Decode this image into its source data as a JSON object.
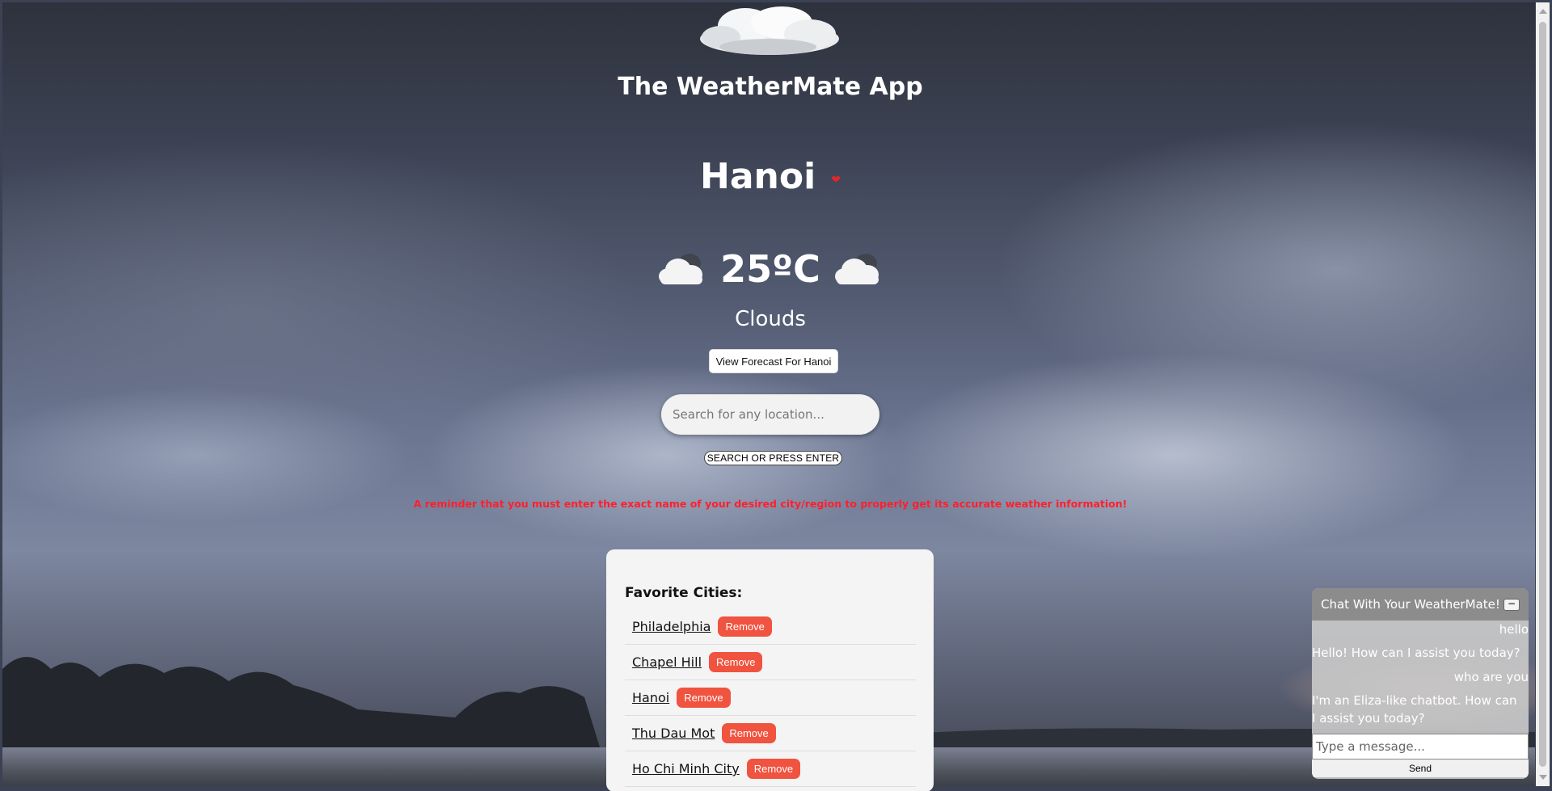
{
  "app": {
    "title": "The WeatherMate App"
  },
  "weather": {
    "city": "Hanoi",
    "temperature": "25ºC",
    "condition": "Clouds",
    "icon": "clouds-icon"
  },
  "forecast_button": {
    "label": "View Forecast For Hanoi"
  },
  "search": {
    "placeholder": "Search for any location...",
    "button_label": "SEARCH OR PRESS ENTER"
  },
  "reminder": "A reminder that you must enter the exact name of your desired city/region to properly get its accurate weather information!",
  "favorites": {
    "heading": "Favorite Cities:",
    "remove_label": "Remove",
    "cities": [
      "Philadelphia",
      "Chapel Hill",
      "Hanoi",
      "Thu Dau Mot",
      "Ho Chi Minh City"
    ]
  },
  "chat": {
    "title": "Chat With Your WeatherMate!",
    "minimize_label": "−",
    "messages": [
      {
        "from": "user",
        "text": "hello"
      },
      {
        "from": "bot",
        "text": "Hello! How can I assist you today?"
      },
      {
        "from": "user",
        "text": "who are you"
      },
      {
        "from": "bot",
        "text": "I'm an Eliza-like chatbot. How can I assist you today?"
      }
    ],
    "input_placeholder": "Type a message...",
    "send_label": "Send"
  },
  "colors": {
    "accent_remove": "#f0533f",
    "reminder_text": "#ff1f2e",
    "heart": "#e3262b"
  }
}
